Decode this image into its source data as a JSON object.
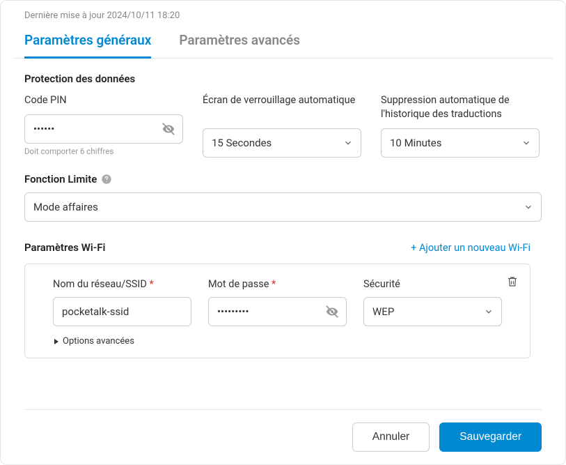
{
  "lastUpdated": "Dernière mise à jour 2024/10/11 18:20",
  "tabs": {
    "general": "Paramètres généraux",
    "advanced": "Paramètres avancés"
  },
  "dataProtection": {
    "heading": "Protection des données",
    "pinLabel": "Code PIN",
    "pinValue": "••••••",
    "pinHelper": "Doit comporter 6 chiffres",
    "autoLockLabel": "Écran de verrouillage automatique",
    "autoLockValue": "15 Secondes",
    "autoDeleteLabel": "Suppression automatique de l'historique des traductions",
    "autoDeleteValue": "10 Minutes"
  },
  "limitation": {
    "heading": "Fonction Limite",
    "value": "Mode affaires"
  },
  "wifi": {
    "heading": "Paramètres Wi-Fi",
    "addLabel": "+ Ajouter un nouveau Wi-Fi",
    "ssidLabel": "Nom du réseau/SSID",
    "ssidValue": "pocketalk-ssid",
    "passwordLabel": "Mot de passe",
    "passwordValue": "•••••••••",
    "securityLabel": "Sécurité",
    "securityValue": "WEP",
    "advancedOptions": "Options avancées"
  },
  "footer": {
    "cancel": "Annuler",
    "save": "Sauvegarder"
  }
}
